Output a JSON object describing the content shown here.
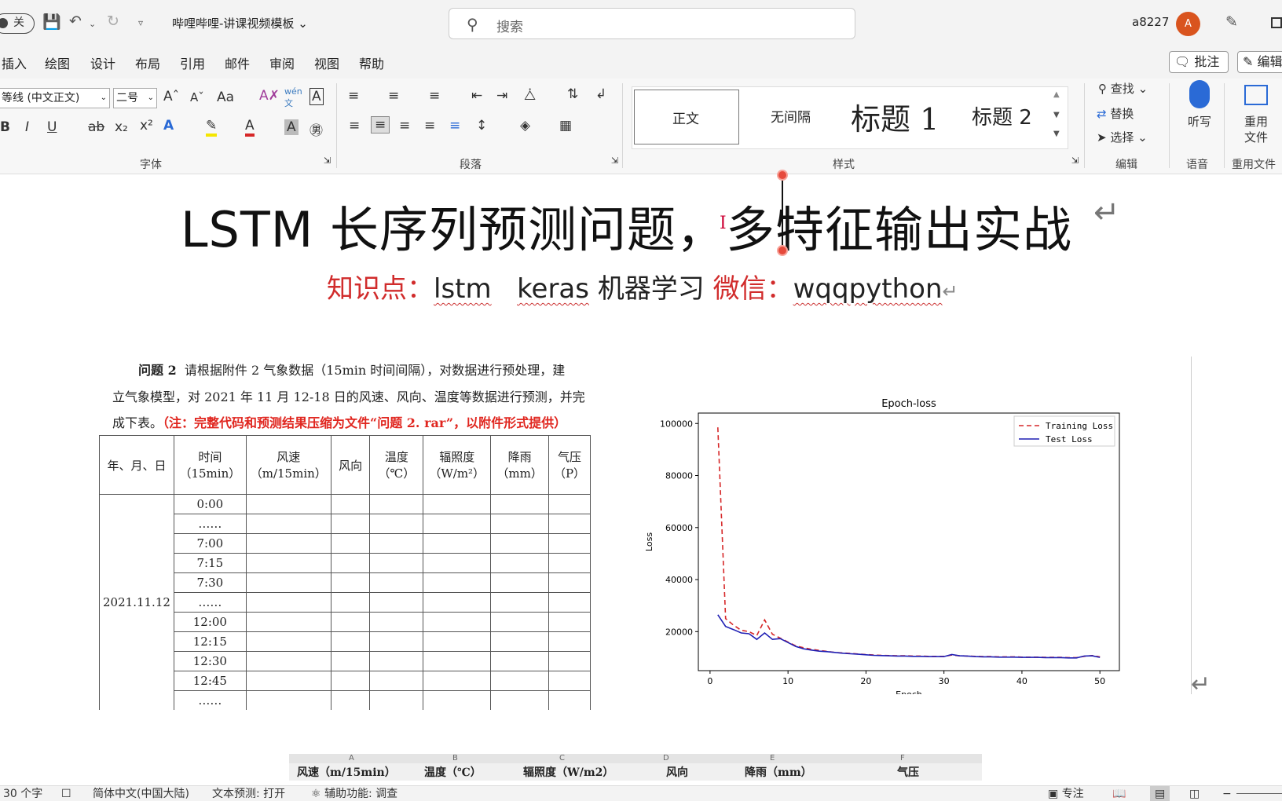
{
  "titlebar": {
    "autosave": "关",
    "doc_title": "哔哩哔哩-讲课视频模板",
    "search_placeholder": "搜索",
    "user_name": "a8227",
    "avatar_initial": "A",
    "accent": "#d9541e"
  },
  "menu": [
    "插入",
    "绘图",
    "设计",
    "布局",
    "引用",
    "邮件",
    "审阅",
    "视图",
    "帮助"
  ],
  "menu_right": {
    "comment": "批注",
    "edit": "编辑"
  },
  "ribbon": {
    "font_name": "等线 (中文正文)",
    "font_size": "二号",
    "aa": "Aa",
    "groups": {
      "font": "字体",
      "paragraph": "段落",
      "styles": "样式",
      "editing": "编辑",
      "voice": "语音",
      "reuse": "重用文件"
    },
    "styles": [
      "正文",
      "无间隔",
      "标题 1",
      "标题 2"
    ],
    "edit_items": [
      "查找",
      "替换",
      "选择"
    ],
    "dictate": "听写",
    "reuse_btn1": "重用",
    "reuse_btn2": "文件"
  },
  "doc": {
    "title": "LSTM 长序列预测问题，多特征输出实战",
    "kp_label": "知识点：",
    "kw1": "lstm",
    "kw2": "keras",
    "kw3": "机器学习",
    "wx_label": "微信：",
    "wx_id": "wqqpython",
    "problem_line1_bold": "问题 2",
    "problem_line1": "请根据附件 2 气象数据（15min 时间间隔），对数据进行预处理，建",
    "problem_line2": "立气象模型，对 2021 年 11 月 12-18 日的风速、风向、温度等数据进行预测，并完",
    "problem_line3a": "成下表。",
    "problem_line3b": "（注：完整代码和预测结果压缩为文件“问题 2. rar”，以附件形式提供）",
    "table_headers": [
      "年、月、日",
      "时间（15min）",
      "风速（m/15min）",
      "风向",
      "温度（℃）",
      "辐照度（W/m²）",
      "降雨（mm）",
      "气压（P）"
    ],
    "table_times": [
      "0:00",
      "……",
      "7:00",
      "7:15",
      "7:30",
      "……",
      "12:00",
      "12:15",
      "12:30",
      "12:45",
      "……"
    ],
    "table_date": "2021.11.12"
  },
  "chart_data": {
    "type": "line",
    "title": "Epoch-loss",
    "xlabel": "Epoch",
    "ylabel": "Loss",
    "xlim": [
      -1.5,
      52.5
    ],
    "ylim": [
      5000,
      104000
    ],
    "xticks": [
      0,
      10,
      20,
      30,
      40,
      50
    ],
    "yticks": [
      20000,
      40000,
      60000,
      80000,
      100000
    ],
    "legend_position": "top-right",
    "grid": false,
    "series": [
      {
        "name": "Training Loss",
        "color": "#d62728",
        "dash": true,
        "x": [
          1,
          2,
          3,
          4,
          5,
          6,
          7,
          8,
          9,
          10,
          11,
          12,
          13,
          14,
          15,
          16,
          17,
          18,
          19,
          20,
          21,
          22,
          23,
          24,
          25,
          26,
          27,
          28,
          29,
          30,
          31,
          32,
          33,
          34,
          35,
          36,
          37,
          38,
          39,
          40,
          41,
          42,
          43,
          44,
          45,
          46,
          47,
          48,
          49,
          50
        ],
        "values": [
          98500,
          25000,
          22500,
          20500,
          20000,
          18500,
          24500,
          19000,
          17500,
          16000,
          14500,
          13800,
          13200,
          12800,
          12400,
          12000,
          11800,
          11600,
          11400,
          11200,
          11000,
          10900,
          10800,
          10700,
          10700,
          10600,
          10600,
          10500,
          10500,
          10500,
          11000,
          10700,
          10600,
          10500,
          10400,
          10400,
          10300,
          10300,
          10300,
          10200,
          10200,
          10200,
          10100,
          10100,
          10100,
          10000,
          10000,
          10500,
          10800,
          10300
        ]
      },
      {
        "name": "Test Loss",
        "color": "#1f1fb4",
        "dash": false,
        "x": [
          1,
          2,
          3,
          4,
          5,
          6,
          7,
          8,
          9,
          10,
          11,
          12,
          13,
          14,
          15,
          16,
          17,
          18,
          19,
          20,
          21,
          22,
          23,
          24,
          25,
          26,
          27,
          28,
          29,
          30,
          31,
          32,
          33,
          34,
          35,
          36,
          37,
          38,
          39,
          40,
          41,
          42,
          43,
          44,
          45,
          46,
          47,
          48,
          49,
          50
        ],
        "values": [
          26500,
          22000,
          20800,
          19500,
          19200,
          17000,
          19500,
          17000,
          17300,
          15800,
          14300,
          13400,
          12900,
          12500,
          12300,
          12000,
          11700,
          11500,
          11300,
          11100,
          10900,
          10800,
          10700,
          10600,
          10600,
          10500,
          10500,
          10400,
          10400,
          10400,
          11200,
          10700,
          10600,
          10400,
          10300,
          10300,
          10200,
          10200,
          10200,
          10100,
          10100,
          10100,
          10000,
          10000,
          10000,
          9900,
          9900,
          10600,
          10700,
          10100
        ]
      }
    ]
  },
  "xlstrip": {
    "cols": [
      "A",
      "B",
      "C",
      "D",
      "E",
      "F"
    ],
    "headers": [
      "风速（m/15min）",
      "温度（℃）",
      "辐照度（W/m2）",
      "风向",
      "降雨（mm）",
      "气压"
    ]
  },
  "status": {
    "words": "30 个字",
    "language": "简体中文(中国大陆)",
    "predict": "文本预测: 打开",
    "access": "辅助功能: 调查",
    "focus": "专注"
  }
}
